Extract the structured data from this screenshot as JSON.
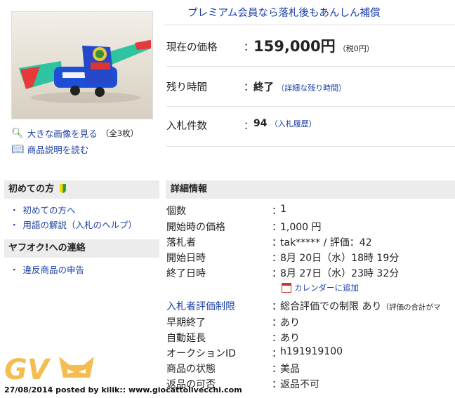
{
  "banner": "プレミアム会員なら落札後もあんしん補償",
  "summary": {
    "price_label": "現在の価格",
    "price_value": "159,000円",
    "price_tax": "（税0円）",
    "time_label": "残り時間",
    "time_value": "終了",
    "time_link": "（詳細な残り時間）",
    "bids_label": "入札件数",
    "bids_value": "94",
    "bids_link": "（入札履歴）",
    "colon": "："
  },
  "image_links": {
    "large_image": "大きな画像を見る",
    "large_image_count": "（全3枚）",
    "description": "商品説明を読む"
  },
  "sidebar": {
    "beginners_title": "初めての方",
    "beginners_links": [
      "初めての方へ",
      "用語の解説（入札のヘルプ）"
    ],
    "contact_title": "ヤフオク!への連絡",
    "contact_links": [
      "違反商品の申告"
    ]
  },
  "details": {
    "title": "詳細情報",
    "rows": [
      {
        "k": "個数",
        "v": "1"
      },
      {
        "k": "開始時の価格",
        "v": "1,000 円"
      },
      {
        "k": "落札者",
        "v": "tak***** / 評価：42"
      },
      {
        "k": "開始日時",
        "v": "8月 20日（水）18時 19分"
      },
      {
        "k": "終了日時",
        "v": "8月 27日（水）23時 32分"
      }
    ],
    "calendar_link": "カレンダーに追加",
    "rows2": [
      {
        "k": "入札者評価制限",
        "v": "総合評価での制限 あり",
        "note": "（評価の合計がマ"
      },
      {
        "k": "早期終了",
        "v": "あり"
      },
      {
        "k": "自動延長",
        "v": "あり"
      },
      {
        "k": "オークションID",
        "v": "h191919100"
      },
      {
        "k": "商品の状態",
        "v": "美品"
      },
      {
        "k": "返品の可否",
        "v": "返品不可"
      }
    ]
  },
  "watermark": {
    "logo_text": "GV"
  },
  "credit": "27/08/2014 posted by kilik:: www.giocattolivecchi.com",
  "colors": {
    "link": "#1a3fa6",
    "header_bg": "#ececec",
    "watermark": "#f2b233"
  }
}
